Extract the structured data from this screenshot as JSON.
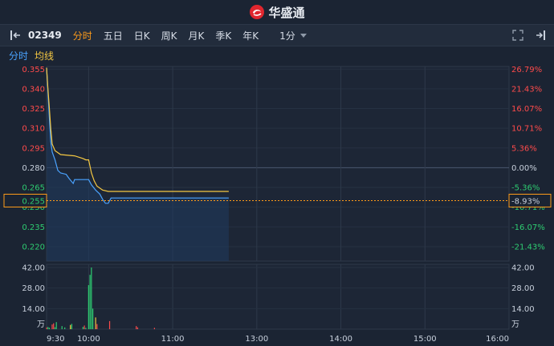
{
  "app": {
    "brand": "华盛通"
  },
  "toolbar": {
    "code": "02349",
    "tabs": [
      "分时",
      "五日",
      "日K",
      "周K",
      "月K",
      "季K",
      "年K"
    ],
    "active_tab": "分时",
    "interval": "1分"
  },
  "legend": {
    "tab": "分时",
    "avg_label": "均线"
  },
  "chart_data": {
    "type": "line",
    "x_ticks": [
      "9:30",
      "10:00",
      "11:00",
      "13:00",
      "14:00",
      "15:00",
      "16:00"
    ],
    "price_axis": [
      "0.355",
      "0.340",
      "0.325",
      "0.310",
      "0.295",
      "0.280",
      "0.265",
      "0.250",
      "0.235",
      "0.220"
    ],
    "pct_axis": [
      "26.79%",
      "21.43%",
      "16.07%",
      "10.71%",
      "5.36%",
      "0.00%",
      "-5.36%",
      "-10.71%",
      "-16.07%",
      "-21.43%"
    ],
    "prev_close": 0.28,
    "ylim": [
      0.209,
      0.357
    ],
    "current_price_label": "0.255",
    "current_pct_label": "-8.93%",
    "current_price": 0.255,
    "volume_axis": [
      "42.00",
      "28.00",
      "14.00"
    ],
    "volume_unit": "万",
    "volume_ylim": [
      0,
      42
    ],
    "series": [
      {
        "name": "分时",
        "color": "#4aa3ff",
        "points": [
          [
            0,
            0.356
          ],
          [
            1,
            0.338
          ],
          [
            2,
            0.318
          ],
          [
            3,
            0.3
          ],
          [
            4,
            0.292
          ],
          [
            6,
            0.286
          ],
          [
            8,
            0.278
          ],
          [
            10,
            0.276
          ],
          [
            14,
            0.275
          ],
          [
            16,
            0.272
          ],
          [
            19,
            0.268
          ],
          [
            20,
            0.271
          ],
          [
            30,
            0.271
          ],
          [
            32,
            0.267
          ],
          [
            35,
            0.263
          ],
          [
            38,
            0.26
          ],
          [
            40,
            0.256
          ],
          [
            42,
            0.253
          ],
          [
            44,
            0.253
          ],
          [
            46,
            0.257
          ],
          [
            50,
            0.257
          ],
          [
            70,
            0.257
          ],
          [
            100,
            0.257
          ],
          [
            130,
            0.257
          ]
        ]
      },
      {
        "name": "均线",
        "color": "#f5c842",
        "points": [
          [
            0,
            0.356
          ],
          [
            1,
            0.34
          ],
          [
            2,
            0.325
          ],
          [
            3,
            0.31
          ],
          [
            4,
            0.298
          ],
          [
            6,
            0.293
          ],
          [
            10,
            0.29
          ],
          [
            20,
            0.289
          ],
          [
            26,
            0.287
          ],
          [
            28,
            0.286
          ],
          [
            30,
            0.286
          ],
          [
            32,
            0.276
          ],
          [
            34,
            0.27
          ],
          [
            36,
            0.266
          ],
          [
            40,
            0.263
          ],
          [
            44,
            0.262
          ],
          [
            50,
            0.262
          ],
          [
            70,
            0.262
          ],
          [
            100,
            0.262
          ],
          [
            130,
            0.262
          ]
        ]
      }
    ],
    "volume": [
      {
        "t": 0,
        "v": 1.2,
        "color": "#ff4b4b"
      },
      {
        "t": 1,
        "v": 1.5,
        "color": "#2ecc71"
      },
      {
        "t": 2,
        "v": 1.0,
        "color": "#2ecc71"
      },
      {
        "t": 4,
        "v": 3.2,
        "color": "#ff4b4b"
      },
      {
        "t": 5,
        "v": 4.0,
        "color": "#ff4b4b"
      },
      {
        "t": 6,
        "v": 1.4,
        "color": "#2ecc71"
      },
      {
        "t": 7,
        "v": 4.8,
        "color": "#2ecc71"
      },
      {
        "t": 11,
        "v": 2.1,
        "color": "#2ecc71"
      },
      {
        "t": 13,
        "v": 1.2,
        "color": "#2ecc71"
      },
      {
        "t": 17,
        "v": 2.9,
        "color": "#f5c842"
      },
      {
        "t": 18,
        "v": 3.6,
        "color": "#2ecc71"
      },
      {
        "t": 26,
        "v": 1.6,
        "color": "#2ecc71"
      },
      {
        "t": 27,
        "v": 2.5,
        "color": "#ff4b4b"
      },
      {
        "t": 28,
        "v": 0.9,
        "color": "#2ecc71"
      },
      {
        "t": 30,
        "v": 30.0,
        "color": "#2ecc71"
      },
      {
        "t": 31,
        "v": 37.0,
        "color": "#2ecc71"
      },
      {
        "t": 32,
        "v": 42.0,
        "color": "#2ecc71"
      },
      {
        "t": 33,
        "v": 14.0,
        "color": "#2ecc71"
      },
      {
        "t": 35,
        "v": 8.0,
        "color": "#f5c842"
      },
      {
        "t": 36,
        "v": 3.5,
        "color": "#ff4b4b"
      },
      {
        "t": 45,
        "v": 5.5,
        "color": "#ff4b4b"
      },
      {
        "t": 64,
        "v": 2.1,
        "color": "#ff4b4b"
      },
      {
        "t": 65,
        "v": 1.2,
        "color": "#ff4b4b"
      },
      {
        "t": 77,
        "v": 0.9,
        "color": "#ff4b4b"
      }
    ],
    "grid": true
  }
}
